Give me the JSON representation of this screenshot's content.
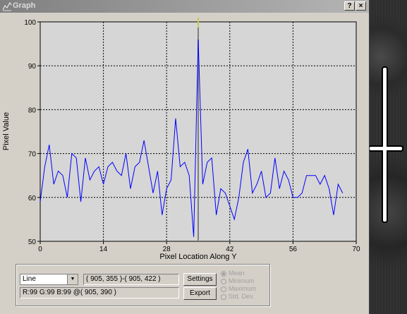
{
  "window": {
    "title": "Graph",
    "help_label": "?",
    "close_label": "×"
  },
  "chart_data": {
    "type": "line",
    "xlabel": "Pixel Location Along Y",
    "ylabel": "Pixel Value",
    "xlim": [
      0,
      70
    ],
    "ylim": [
      50,
      100
    ],
    "x_ticks": [
      0,
      14,
      28,
      42,
      56,
      70
    ],
    "y_ticks": [
      50,
      60,
      70,
      80,
      90,
      100
    ],
    "grid": true,
    "marker_x": 35,
    "series": [
      {
        "color": "#0000ff",
        "x": [
          0,
          1,
          2,
          3,
          4,
          5,
          6,
          7,
          8,
          9,
          10,
          11,
          12,
          13,
          14,
          15,
          16,
          17,
          18,
          19,
          20,
          21,
          22,
          23,
          24,
          25,
          26,
          27,
          28,
          29,
          30,
          31,
          32,
          33,
          34,
          35,
          36,
          37,
          38,
          39,
          40,
          41,
          42,
          43,
          44,
          45,
          46,
          47,
          48,
          49,
          50,
          51,
          52,
          53,
          54,
          55,
          56,
          57,
          58,
          59,
          60,
          61,
          62,
          63,
          64,
          65,
          66,
          67
        ],
        "y": [
          59,
          67,
          72,
          63,
          66,
          65,
          60,
          70,
          69,
          59,
          69,
          64,
          66,
          67,
          63,
          67,
          68,
          66,
          65,
          70,
          62,
          67,
          68,
          73,
          67,
          61,
          66,
          56,
          62,
          64,
          78,
          67,
          68,
          65,
          51,
          96,
          63,
          68,
          69,
          56,
          62,
          61,
          58,
          55,
          60,
          68,
          71,
          61,
          63,
          66,
          60,
          61,
          69,
          62,
          66,
          64,
          60,
          60,
          61,
          65,
          65,
          65,
          63,
          65,
          62,
          56,
          63,
          61
        ]
      }
    ]
  },
  "controls": {
    "mode_select": "Line",
    "coords_range": "( 905, 355 )-( 905, 422 )",
    "pixel_readout": "R:99 G:99 B:99 @( 905, 390 )",
    "settings_label": "Settings",
    "export_label": "Export",
    "radio_options": [
      "Mean",
      "Minimum",
      "Maximum",
      "Std. Dev."
    ]
  }
}
